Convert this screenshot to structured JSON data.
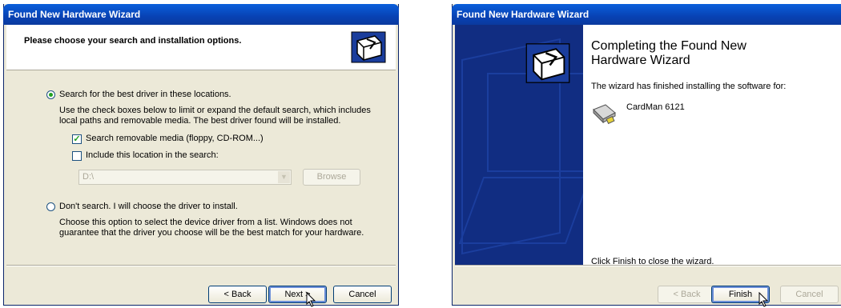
{
  "window1": {
    "title": "Found New Hardware Wizard",
    "header": "Please choose your search and installation options.",
    "option_search": {
      "label": "Search for the best driver in these locations.",
      "description": "Use the check boxes below to limit or expand the default search, which includes local paths and removable media. The best driver found will be installed.",
      "check_removable": "Search removable media (floppy, CD-ROM...)",
      "check_location": "Include this location in the search:",
      "location_value": "D:\\",
      "browse_label": "Browse"
    },
    "option_dont_search": {
      "label": "Don't search. I will choose the driver to install.",
      "description": "Choose this option to select the device driver from a list.  Windows does not guarantee that the driver you choose will be the best match for your hardware."
    },
    "buttons": {
      "back": "< Back",
      "next": "Next >",
      "cancel": "Cancel"
    }
  },
  "window2": {
    "title": "Found New Hardware Wizard",
    "heading": "Completing the Found New Hardware Wizard",
    "finished_text": "The wizard has finished installing the software for:",
    "device_name": "CardMan 6121",
    "close_text": "Click Finish to close the wizard.",
    "buttons": {
      "back": "< Back",
      "finish": "Finish",
      "cancel": "Cancel"
    }
  },
  "colors": {
    "title_bar": "#0842b4",
    "side_panel": "#112d82",
    "dialog_bg": "#ece9d8",
    "check_green": "#21a121"
  }
}
